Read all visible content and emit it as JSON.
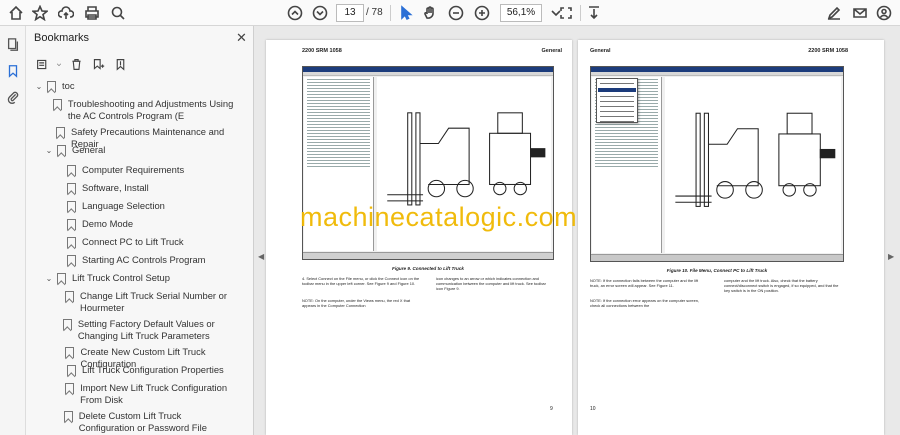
{
  "toolbar": {
    "page_current": "13",
    "page_total": "/ 78",
    "zoom": "56,1%"
  },
  "bookmarks": {
    "title": "Bookmarks",
    "close": "✕",
    "items": [
      {
        "label": "toc",
        "level": 0,
        "expanded": true
      },
      {
        "label": "Troubleshooting and Adjustments Using the AC Controls Program (E",
        "level": 1
      },
      {
        "label": "Safety Precautions Maintenance and Repair",
        "level": 1
      },
      {
        "label": "General",
        "level": 1,
        "expanded": true
      },
      {
        "label": "Computer Requirements",
        "level": 2
      },
      {
        "label": "Software, Install",
        "level": 2
      },
      {
        "label": "Language Selection",
        "level": 2
      },
      {
        "label": "Demo Mode",
        "level": 2
      },
      {
        "label": "Connect PC to Lift Truck",
        "level": 2
      },
      {
        "label": "Starting AC Controls Program",
        "level": 2
      },
      {
        "label": "Lift Truck Control Setup",
        "level": 1,
        "expanded": true
      },
      {
        "label": "Change Lift Truck Serial Number or Hourmeter",
        "level": 2
      },
      {
        "label": "Setting Factory Default Values or Changing Lift Truck Parameters",
        "level": 2
      },
      {
        "label": "Create New Custom Lift Truck Configuration",
        "level": 2
      },
      {
        "label": "Lift Truck Configuration Properties",
        "level": 2
      },
      {
        "label": "Import New Lift Truck Configuration From Disk",
        "level": 2
      },
      {
        "label": "Delete Custom Lift Truck Configuration or Password File",
        "level": 2
      }
    ]
  },
  "left_page": {
    "header_left": "2200 SRM 1058",
    "header_right": "General",
    "caption": "Figure 9. Connected to Lift Truck",
    "col1_a": "4.   Select Connect on the File menu, or click the Connect icon on the toolbar menu in the upper left corner. See Figure 9 and Figure 10.",
    "col1_b": "NOTE: On the computer, under the Views menu, the red X that appears in the Computer Connection",
    "col2": "icon changes to an arrow or which indicates connection and communication between the computer and lift truck. See toolbar icon Figure 9.",
    "page_number": "9"
  },
  "right_page": {
    "header_left": "General",
    "header_right": "2200 SRM 1058",
    "caption": "Figure 10. File Menu, Connect PC to Lift Truck",
    "col1_a": "NOTE: If the connection fails between the computer and the lift truck, an error screen will appear. See Figure 11.",
    "col1_b": "NOTE: If the connection error appears on the computer screen, check all connections between the",
    "col2": "computer and the lift truck. Also, check that the battery connect/disconnect switch is engaged, if so equipped, and that the key switch is in the ON position.",
    "page_number": "10"
  },
  "watermark": "machinecatalogic.com"
}
